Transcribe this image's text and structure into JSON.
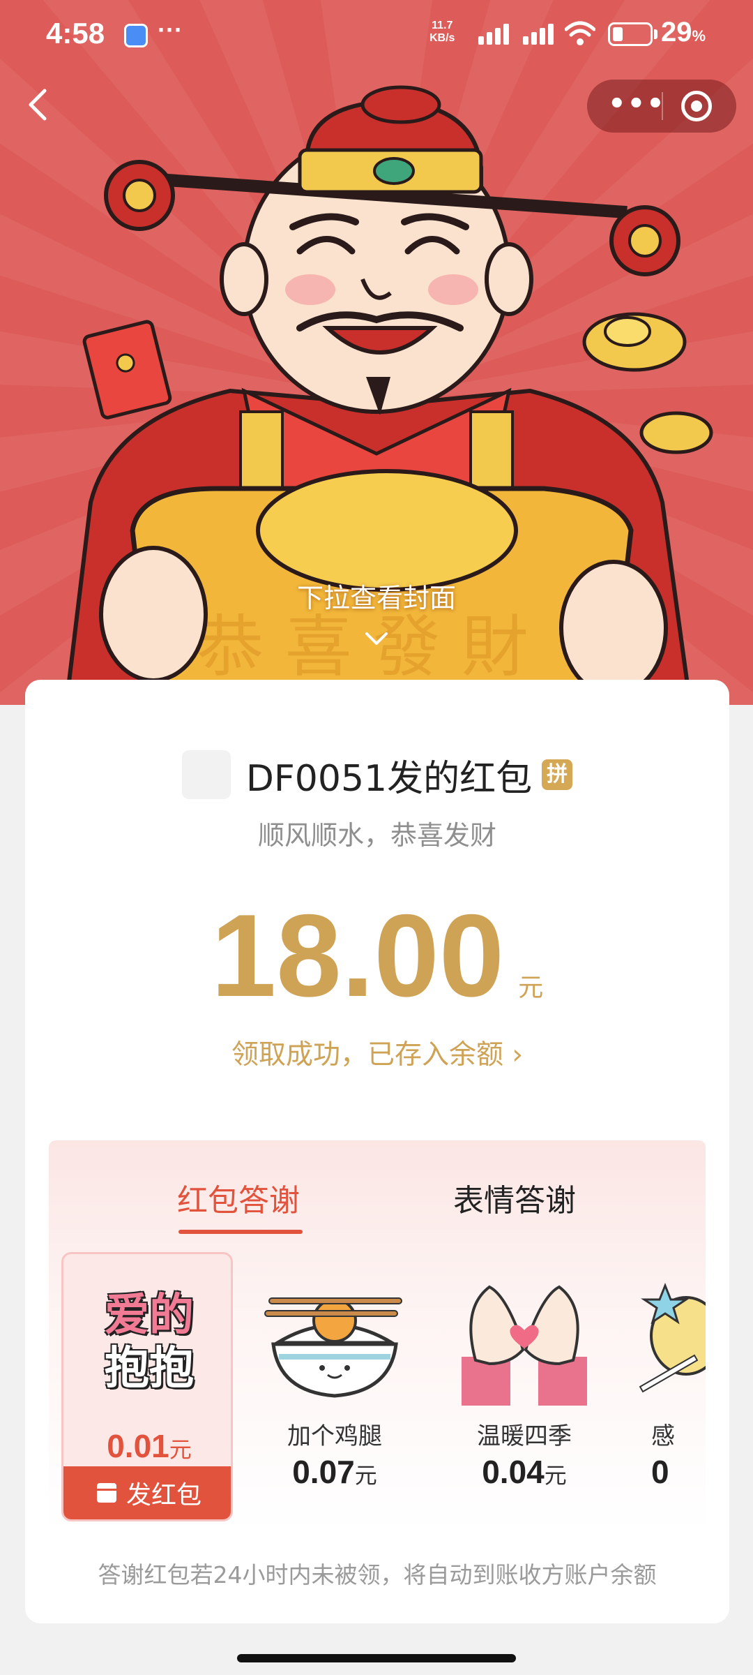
{
  "status_bar": {
    "time": "4:58",
    "more_dots": "···",
    "net_speed_value": "11.7",
    "net_speed_unit": "KB/s",
    "battery_percent": "29",
    "battery_percent_sign": "%",
    "battery_level": 0.29
  },
  "top_nav": {
    "back_icon": "chevron-left-icon",
    "more_icon": "more-dots-icon",
    "close_icon": "target-close-icon"
  },
  "cover": {
    "pull_hint": "下拉查看封面",
    "pull_icon": "chevron-down-icon"
  },
  "packet": {
    "sender": "DF0051发的红包",
    "badge": "拼",
    "wish": "顺风顺水，恭喜发财",
    "amount": "18.00",
    "amount_unit": "元",
    "received_note": "领取成功，已存入余额",
    "received_arrow": "›"
  },
  "thanks": {
    "tabs": [
      {
        "label": "红包答谢",
        "active": true
      },
      {
        "label": "表情答谢",
        "active": false
      }
    ],
    "selected_gift": {
      "art_line1": "爱的",
      "art_line2": "抱抱",
      "price": "0.01",
      "unit": "元",
      "send_label": "发红包"
    },
    "gifts": [
      {
        "name": "加个鸡腿",
        "price": "0.07",
        "unit": "元",
        "icon": "rice-bowl-drumstick-icon"
      },
      {
        "name": "温暖四季",
        "price": "0.04",
        "unit": "元",
        "icon": "heart-hands-icon"
      },
      {
        "name": "感",
        "price": "0",
        "unit": "",
        "icon": "star-gift-icon"
      }
    ],
    "footnote": "答谢红包若24小时内未被领，将自动到账收方账户余额"
  },
  "colors": {
    "cover_red": "#dd5b58",
    "gold": "#cfa356",
    "accent_red": "#e2533d",
    "badge_gold": "#d5a855"
  }
}
